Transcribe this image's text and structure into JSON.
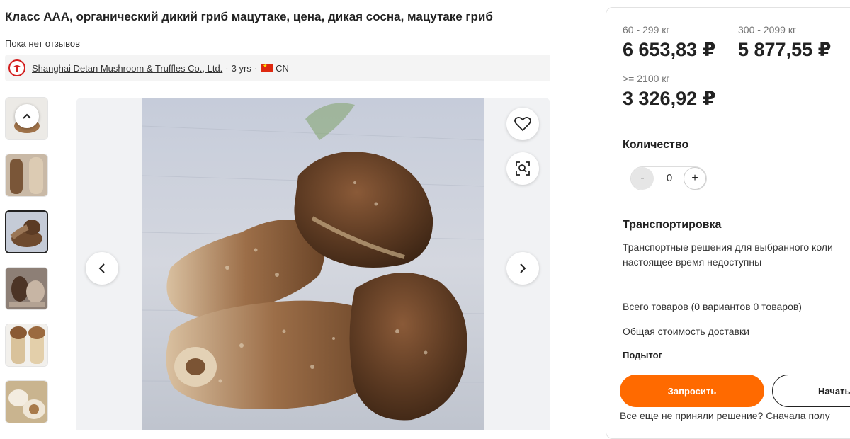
{
  "product": {
    "title": "Класс ААА, органический дикий гриб мацутаке, цена, дикая сосна, мацутаке гриб",
    "reviews": "Пока нет отзывов"
  },
  "supplier": {
    "name": "Shanghai Detan Mushroom & Truffles Co., Ltd.",
    "separator": "·",
    "years": "3 yrs",
    "country": "CN"
  },
  "gallery": {
    "thumbnail_count": 6,
    "active_thumbnail": 3,
    "icons": [
      "chevron-up-icon",
      "heart-icon",
      "image-search-icon",
      "chevron-left-icon",
      "chevron-right-icon"
    ]
  },
  "pricing": {
    "tiers": [
      {
        "range": "60 - 299 кг",
        "price": "6 653,83 ₽"
      },
      {
        "range": "300 - 2099 кг",
        "price": "5 877,55 ₽"
      },
      {
        "range": ">= 2100 кг",
        "price": "3 326,92 ₽"
      }
    ]
  },
  "quantity": {
    "label": "Количество",
    "minus": "-",
    "value": "0",
    "plus": "+"
  },
  "shipping": {
    "title": "Транспортировка",
    "text": "Транспортные решения для выбранного коли\nнастоящее время недоступны"
  },
  "summary": {
    "total_goods": "Всего товаров (0 вариантов 0 товаров)",
    "total_shipping": "Общая стоимость доставки",
    "subtotal": "Подытог"
  },
  "actions": {
    "request": "Запросить",
    "start": "Начать",
    "undecided": "Все еще не приняли решение? Сначала полу"
  },
  "colors": {
    "accent": "#ff6a00",
    "logo_red": "#d32020"
  }
}
